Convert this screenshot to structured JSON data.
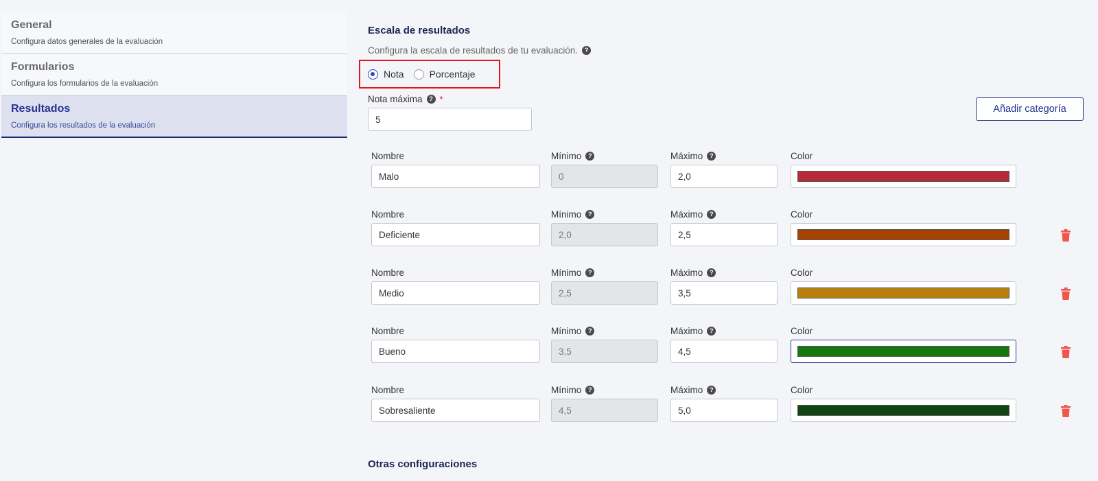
{
  "sidebar": {
    "items": [
      {
        "title": "General",
        "desc": "Configura datos generales de la evaluación"
      },
      {
        "title": "Formularios",
        "desc": "Configura los formularios de la evaluación"
      },
      {
        "title": "Resultados",
        "desc": "Configura los resultados de la evaluación"
      }
    ]
  },
  "scale": {
    "title": "Escala de resultados",
    "desc": "Configura la escala de resultados de tu evaluación.",
    "options": [
      "Nota",
      "Porcentaje"
    ],
    "selected": "Nota",
    "max_label": "Nota máxima",
    "required_mark": "*",
    "max_value": "5",
    "add_button": "Añadir categoría"
  },
  "labels": {
    "name": "Nombre",
    "min": "Mínimo",
    "max": "Máximo",
    "color": "Color",
    "help": "?"
  },
  "categories": [
    {
      "name": "Malo",
      "min": "0",
      "max": "2,0",
      "color": "#b82a3a",
      "deletable": false
    },
    {
      "name": "Deficiente",
      "min": "2,0",
      "max": "2,5",
      "color": "#a84200",
      "deletable": true
    },
    {
      "name": "Medio",
      "min": "2,5",
      "max": "3,5",
      "color": "#b8800e",
      "deletable": true
    },
    {
      "name": "Bueno",
      "min": "3,5",
      "max": "4,5",
      "color": "#14780f",
      "deletable": true
    },
    {
      "name": "Sobresaliente",
      "min": "4,5",
      "max": "5,0",
      "color": "#0f4510",
      "deletable": true
    }
  ],
  "other": {
    "title": "Otras configuraciones"
  },
  "icons": {
    "help": "help-icon",
    "delete": "trash-icon"
  },
  "colors": {
    "accent": "#263393",
    "danger": "#f0564b",
    "highlight": "#e4141d"
  }
}
